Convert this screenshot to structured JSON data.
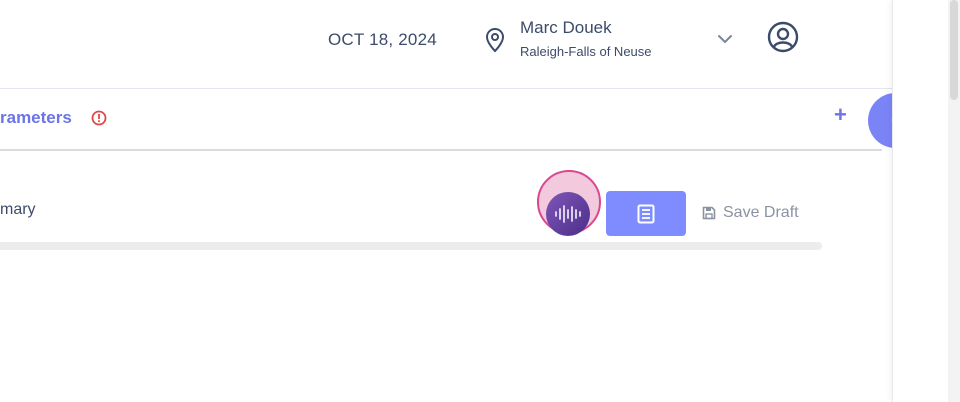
{
  "header": {
    "date": "OCT 18, 2024",
    "user_name": "Marc Douek",
    "user_location": "Raleigh-Falls of Neuse"
  },
  "section": {
    "title": "rameters"
  },
  "summary": {
    "label": "mary",
    "save_draft": "Save Draft"
  },
  "colors": {
    "accent": "#6b74e8",
    "button": "#7e8cff",
    "alert": "#e04848",
    "mic_ring": "#d9488f"
  },
  "icons": [
    "location-pin-icon",
    "chevron-down-icon",
    "user-circle-icon",
    "alert-circle-icon",
    "plus-icon",
    "chevron-left-icon",
    "audio-wave-icon",
    "document-icon",
    "save-icon"
  ]
}
